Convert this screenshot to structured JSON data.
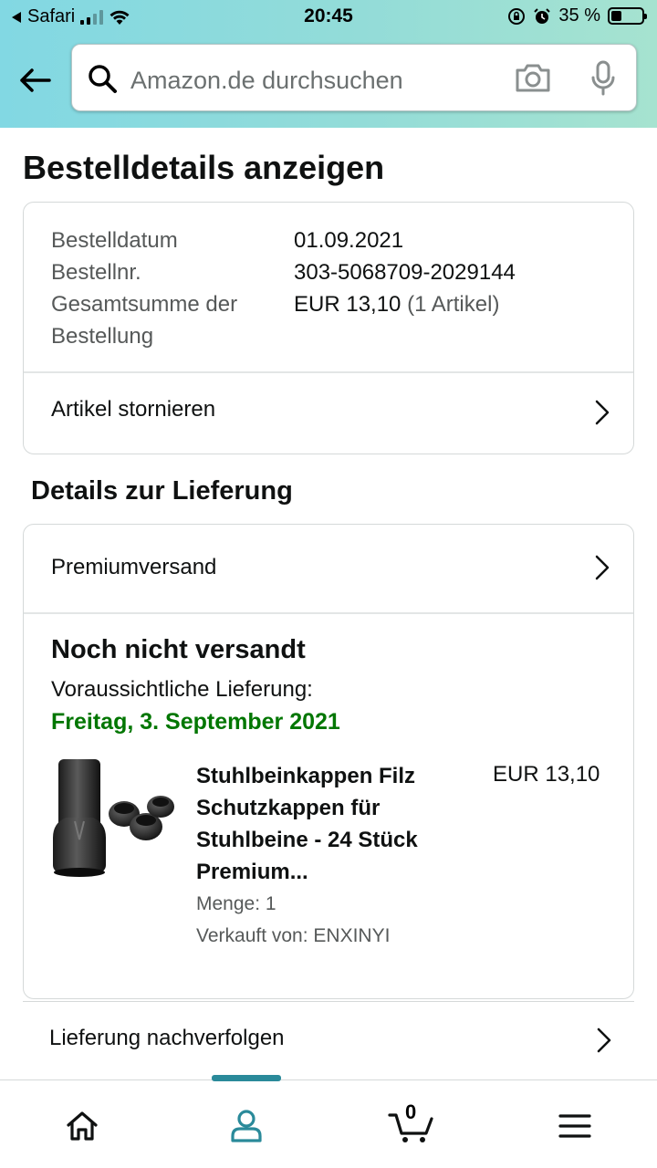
{
  "statusbar": {
    "carrier": "Safari",
    "time": "20:45",
    "battery": "35 %",
    "battery_level": 0.35
  },
  "search": {
    "placeholder": "Amazon.de durchsuchen",
    "icons": [
      "search-icon",
      "camera-icon",
      "microphone-icon"
    ]
  },
  "page": {
    "title": "Bestelldetails anzeigen"
  },
  "order": {
    "date_label": "Bestelldatum",
    "date_value": "01.09.2021",
    "number_label": "Bestellnr.",
    "number_value": "303-5068709-2029144",
    "total_label": "Gesamtsumme der Bestellung",
    "total_value": "EUR 13,10",
    "total_items": "(1 Artikel)",
    "cancel_label": "Artikel stornieren"
  },
  "delivery": {
    "section_title": "Details zur Lieferung",
    "shipping_method": "Premiumversand",
    "status": "Noch nicht versandt",
    "expected_label": "Voraussichtliche Lieferung:",
    "expected_date": "Freitag, 3. September 2021",
    "track_label": "Lieferung nachverfolgen"
  },
  "product": {
    "title": "Stuhlbeinkappen Filz Schutzkappen für Stuhlbeine - 24 Stück Premium...",
    "price": "EUR 13,10",
    "quantity": "Menge: 1",
    "seller": "Verkauft von: ENXINYI"
  },
  "bottomnav": {
    "items": [
      "home-icon",
      "account-icon",
      "cart-icon",
      "menu-icon"
    ],
    "cart_count": "0",
    "active_color": "#2a8a9a"
  },
  "colors": {
    "delivery_green": "#007600",
    "border": "#d5d9d9",
    "header_gradient_start": "#82d8e3",
    "header_gradient_end": "#a6e3d0"
  }
}
